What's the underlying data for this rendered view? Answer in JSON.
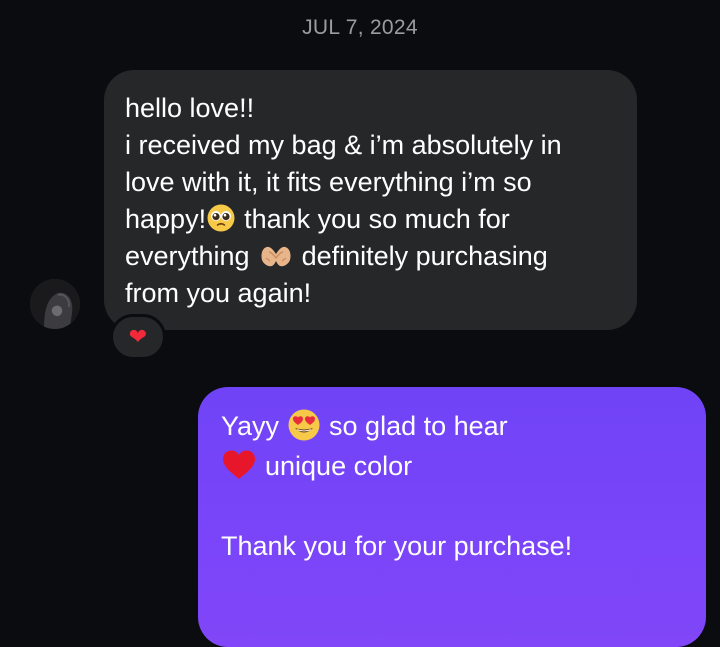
{
  "conversation": {
    "date": "JUL 7, 2024"
  },
  "incoming": {
    "lines": [
      "hello love!!",
      "i received my bag & i’m absolutely in",
      "love with it, it fits everything i’m so",
      "happy!",
      "thank you so much for",
      "everything",
      "definitely purchasing",
      "from you again!"
    ],
    "reaction": "❤",
    "emoji_icons": [
      "pleading-face-icon",
      "heart-hands-icon"
    ]
  },
  "outgoing": {
    "line1_prefix": "Yayy",
    "line1_suffix": "so glad to hear",
    "line2_suffix": "unique color",
    "line4": "Thank you for your purchase!",
    "emoji_icons": [
      "heart-eyes-icon",
      "red-heart-icon"
    ]
  },
  "colors": {
    "background": "#0b0c10",
    "incoming_bubble": "#262729",
    "outgoing_bubble": "#7a45f9",
    "date_text": "#9b9ca3",
    "reaction_heart": "#f02a3a"
  }
}
